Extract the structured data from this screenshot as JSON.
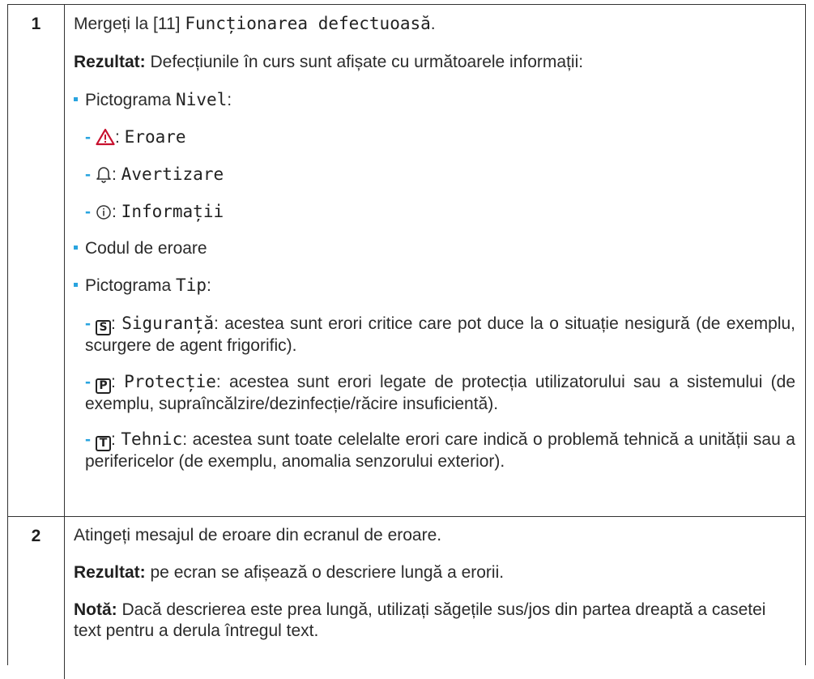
{
  "rows": [
    {
      "number": "1",
      "step_prefix": "Mergeți la [11] ",
      "step_menu": "Funcționarea defectuoasă",
      "step_suffix": ".",
      "result_label": "Rezultat:",
      "result_text": " Defecțiunile în curs sunt afișate cu următoarele informații:",
      "level_prefix": "Pictograma ",
      "level_name": "Nivel",
      "level_suffix": ":",
      "levels": [
        {
          "icon": "warning-triangle-icon",
          "label": "Eroare"
        },
        {
          "icon": "bell-icon",
          "label": "Avertizare"
        },
        {
          "icon": "info-circle-icon",
          "label": "Informații"
        }
      ],
      "error_code": "Codul de eroare",
      "type_prefix": "Pictograma ",
      "type_name": "Tip",
      "type_suffix": ":",
      "types": [
        {
          "icon_letter": "S",
          "name": "Siguranță",
          "desc": ": acestea sunt erori critice care pot duce la o situație nesigură (de exemplu, scurgere de agent frigorific)."
        },
        {
          "icon_letter": "P",
          "name": "Protecție",
          "desc": ": acestea sunt erori legate de protecția utilizatorului sau a sistemului (de exemplu, supraîncălzire/dezinfecție/răcire insuficientă)."
        },
        {
          "icon_letter": "T",
          "name": "Tehnic",
          "desc": ": acestea sunt toate celelalte erori care indică o problemă tehnică a unității sau a perifericelor (de exemplu, anomalia senzorului exterior)."
        }
      ]
    },
    {
      "number": "2",
      "step": "Atingeți mesajul de eroare din ecranul de eroare.",
      "result_label": "Rezultat:",
      "result_text": " pe ecran se afișează o descriere lungă a erorii.",
      "note_label": "Notă:",
      "note_text": " Dacă descrierea este prea lungă, utilizați săgețile sus/jos din partea dreaptă a casetei text pentru a derula întregul text."
    }
  ],
  "colors": {
    "accent": "#29a4df",
    "warning": "#c8102e",
    "border": "#333333"
  }
}
